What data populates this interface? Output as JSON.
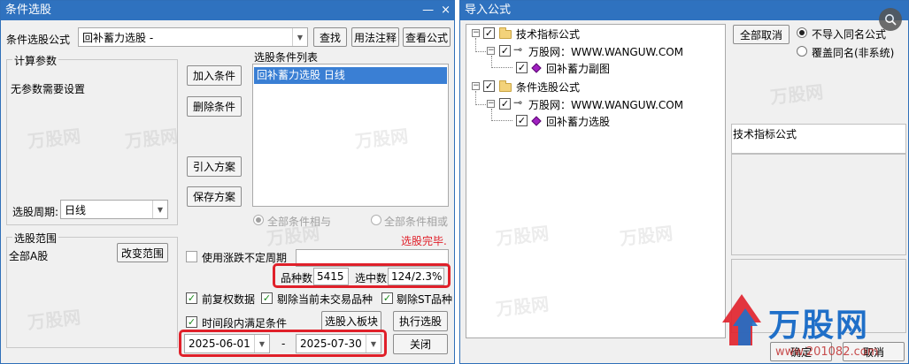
{
  "left_window": {
    "title": "条件选股",
    "title_buttons": [
      "—",
      "×"
    ],
    "formula_label": "条件选股公式",
    "formula_value": "回补蓄力选股  -",
    "btn_find": "查找",
    "btn_usage": "用法注释",
    "btn_view": "查看公式",
    "params_group": "计算参数",
    "params_text": "无参数需要设置",
    "period_label": "选股周期:",
    "period_value": "日线",
    "btn_add": "加入条件",
    "btn_delete": "删除条件",
    "btn_import_plan": "引入方案",
    "btn_save_plan": "保存方案",
    "cond_list_label": "选股条件列表",
    "cond_items": [
      "回补蓄力选股  日线"
    ],
    "radio_and": "全部条件相与",
    "radio_or": "全部条件相或",
    "status_text": "选股完毕.",
    "range_group": "选股范围",
    "range_value": "全部A股",
    "btn_change_range": "改变范围",
    "chk_variable_period": "使用涨跌不定周期",
    "count_label": "品种数",
    "count_value": "5415",
    "selected_label": "选中数",
    "selected_value": "124/2.3%",
    "chk_forward_adj": "前复权数据",
    "chk_remove_untraded": "剔除当前未交易品种",
    "chk_remove_st": "剔除ST品种",
    "chk_time_range": "时间段内满足条件",
    "btn_to_block": "选股入板块",
    "btn_execute": "执行选股",
    "date_from": "2025-06-01",
    "date_sep": "-",
    "date_to": "2025-07-30",
    "btn_close": "关闭",
    "check_mark": "✓",
    "dropdown_arrow": "▼"
  },
  "right_window": {
    "title": "导入公式",
    "tree": {
      "root1": "技术指标公式",
      "child1": "万股网：WWW.WANGUW.COM",
      "leaf1": "回补蓄力副图",
      "root2": "条件选股公式",
      "child2": "万股网：WWW.WANGUW.COM",
      "leaf2": "回补蓄力选股"
    },
    "btn_cancel_all": "全部取消",
    "radio_no_import": "不导入同名公式",
    "radio_overwrite": "覆盖同名(非系统)",
    "panel_label": "技术指标公式",
    "btn_ok": "确定",
    "btn_cancel": "取消"
  },
  "watermark": {
    "text": "万股网",
    "logo_text": "万股网",
    "logo_url_text": "www.201082.com"
  },
  "colors": {
    "titlebar": "#2f72bf",
    "highlight": "#e0202a",
    "status_red": "#e0202a",
    "selection": "#3a7fd4",
    "logo_blue": "#1f6fc8"
  }
}
